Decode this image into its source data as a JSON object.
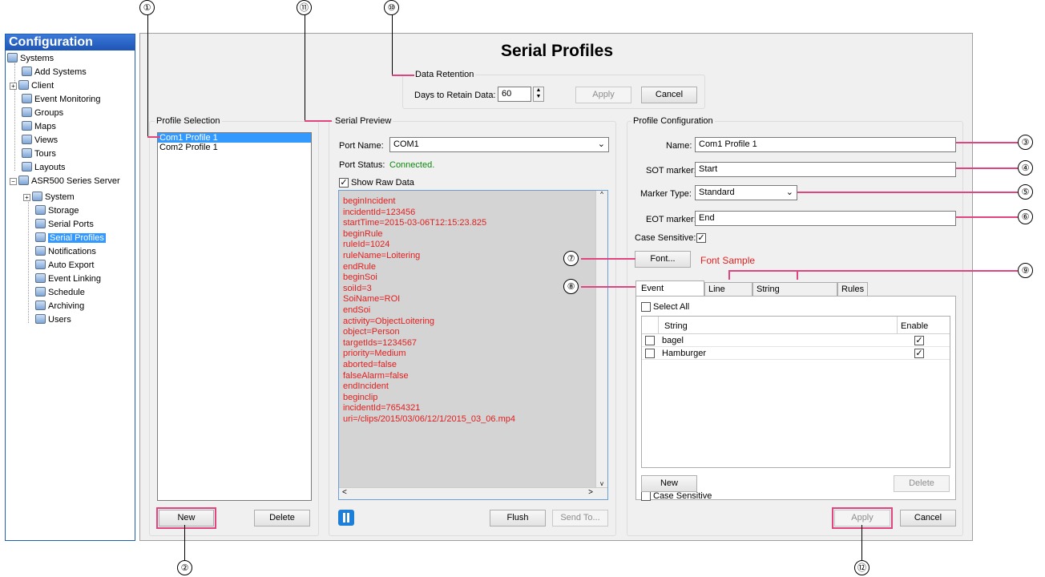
{
  "tree": {
    "header": "Configuration",
    "items": [
      {
        "label": "Systems"
      },
      {
        "label": "Add Systems"
      },
      {
        "label": "Client"
      },
      {
        "label": "Event Monitoring"
      },
      {
        "label": "Groups"
      },
      {
        "label": "Maps"
      },
      {
        "label": "Views"
      },
      {
        "label": "Tours"
      },
      {
        "label": "Layouts"
      },
      {
        "label": "ASR500 Series Server"
      },
      {
        "label": "System"
      },
      {
        "label": "Storage"
      },
      {
        "label": "Serial Ports"
      },
      {
        "label": "Serial Profiles"
      },
      {
        "label": "Notifications"
      },
      {
        "label": "Auto Export"
      },
      {
        "label": "Event Linking"
      },
      {
        "label": "Schedule"
      },
      {
        "label": "Archiving"
      },
      {
        "label": "Users"
      }
    ]
  },
  "page_title": "Serial Profiles",
  "retention": {
    "group_title": "Data Retention",
    "days_label": "Days to Retain Data:",
    "days_value": "60",
    "apply": "Apply",
    "cancel": "Cancel"
  },
  "profile_selection": {
    "group_title": "Profile Selection",
    "items": [
      "Com1 Profile 1",
      "Com2 Profile 1"
    ],
    "new": "New",
    "delete": "Delete"
  },
  "preview": {
    "group_title": "Serial Preview",
    "port_name_label": "Port Name:",
    "port_name_value": "COM1",
    "port_status_label": "Port Status:",
    "port_status_value": "Connected.",
    "show_raw_label": "Show Raw Data",
    "raw_lines": [
      "beginIncident",
      "incidentId=123456",
      "startTime=2015-03-06T12:15:23.825",
      "beginRule",
      "ruleId=1024",
      "ruleName=Loitering",
      "endRule",
      "beginSoi",
      "soiId=3",
      "SoiName=ROI",
      "endSoi",
      "activity=ObjectLoitering",
      "object=Person",
      "targetIds=1234567",
      "priority=Medium",
      "aborted=false",
      "falseAlarm=false",
      "endIncident",
      "beginclip",
      "incidentId=7654321",
      "uri=/clips/2015/03/06/12/1/2015_03_06.mp4"
    ],
    "flush": "Flush",
    "send_to": "Send To..."
  },
  "config": {
    "group_title": "Profile Configuration",
    "name_label": "Name:",
    "name_value": "Com1 Profile 1",
    "sot_label": "SOT marker:",
    "sot_value": "Start",
    "marker_type_label": "Marker Type:",
    "marker_type_value": "Standard",
    "eot_label": "EOT marker:",
    "eot_value": "End",
    "case_label": "Case Sensitive:",
    "font_button": "Font...",
    "font_sample": "Font Sample",
    "tabs": [
      "Event Keywords",
      "Line Masks",
      "String Replacements",
      "Rules"
    ],
    "select_all": "Select All",
    "col_string": "String",
    "col_enable": "Enable",
    "rows": [
      {
        "string": "bagel"
      },
      {
        "string": "Hamburger"
      }
    ],
    "case_sensitive_tab": "Case Sensitive",
    "new": "New",
    "delete": "Delete",
    "apply": "Apply",
    "cancel": "Cancel"
  },
  "callouts": {
    "c1": "①",
    "c2": "②",
    "c3": "③",
    "c4": "④",
    "c5": "⑤",
    "c6": "⑥",
    "c7": "⑦",
    "c8": "⑧",
    "c9": "⑨",
    "c10": "⑩",
    "c11": "⑪",
    "c12": "⑫"
  },
  "colors": {
    "accent_callout": "#e0457f",
    "raw_text": "#e02020",
    "status_green": "#0a8a0a",
    "selection": "#3399ff"
  }
}
